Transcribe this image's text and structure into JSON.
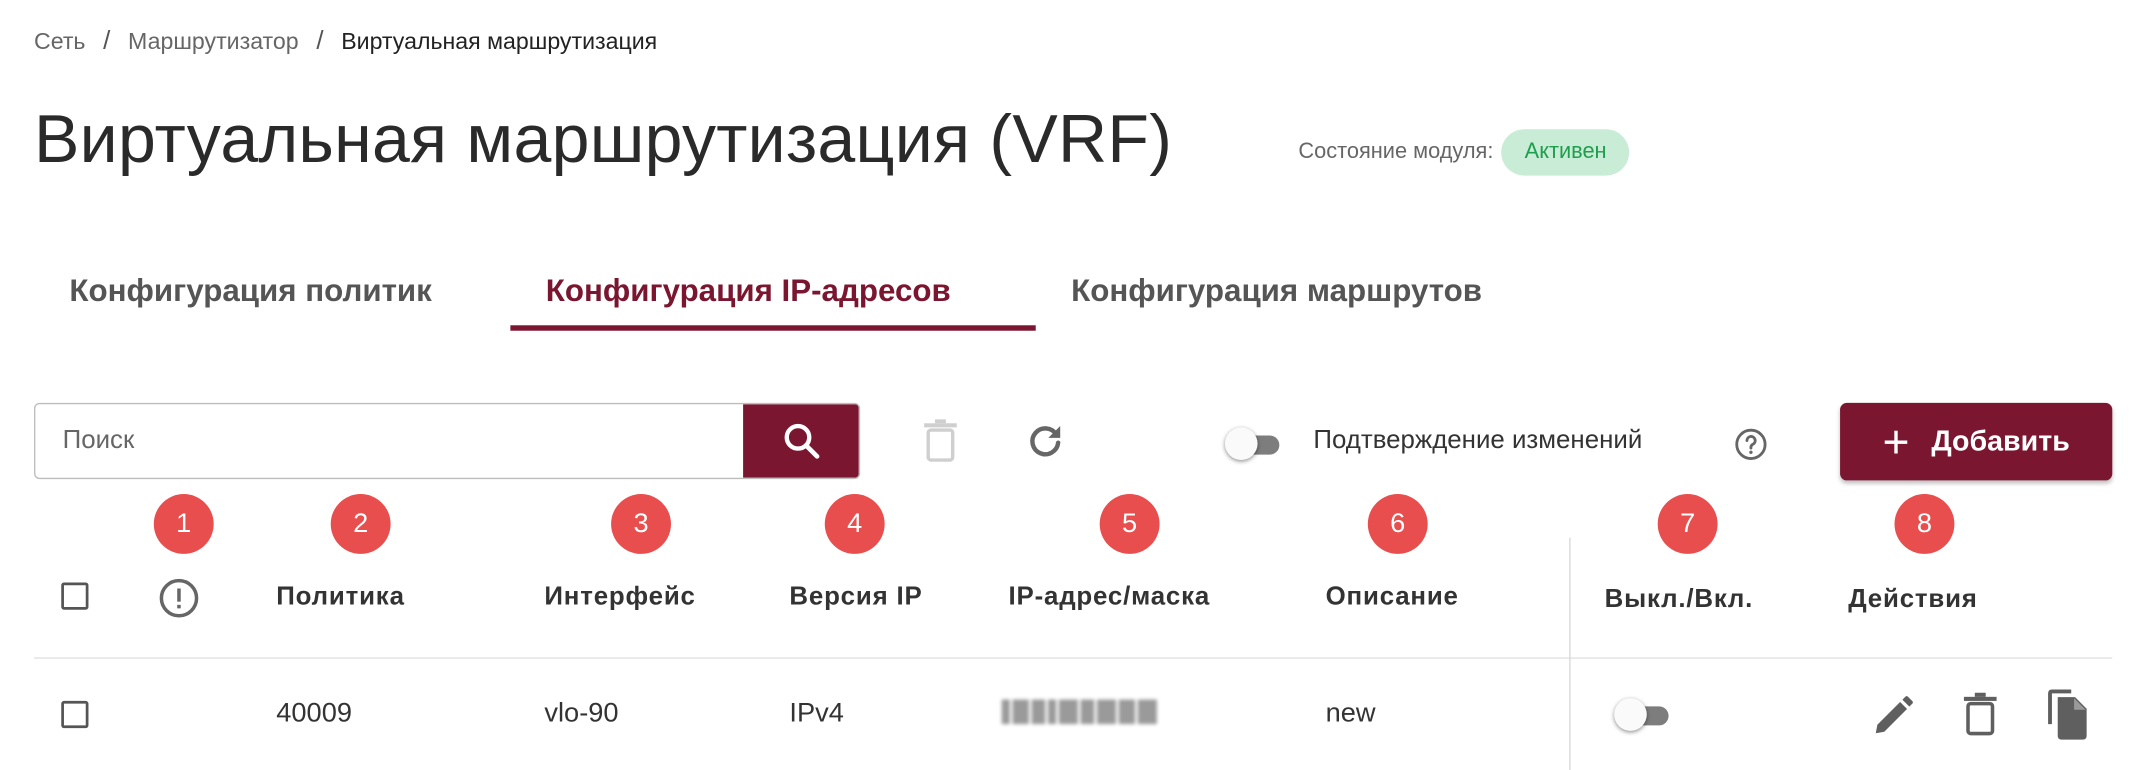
{
  "breadcrumb": [
    "Сеть",
    "Маршрутизатор",
    "Виртуальная маршрутизация"
  ],
  "breadcrumb_separator": "/",
  "page_title": "Виртуальная маршрутизация (VRF)",
  "module_status": {
    "label": "Состояние модуля:",
    "value": "Активен",
    "color": "#1f9e4d",
    "background": "#c9ecd6"
  },
  "tabs": [
    {
      "label": "Конфигурация политик",
      "active": false
    },
    {
      "label": "Конфигурация IP-адресов",
      "active": true
    },
    {
      "label": "Конфигурация маршрутов",
      "active": false
    }
  ],
  "toolbar": {
    "search_placeholder": "Поиск",
    "search_icon": "search-icon",
    "delete_icon": "trash-icon",
    "refresh_icon": "refresh-icon",
    "confirm_label": "Подтверждение изменений",
    "confirm_enabled": false,
    "help_icon": "help-circle-icon",
    "add_label": "Добавить"
  },
  "markers": [
    "1",
    "2",
    "3",
    "4",
    "5",
    "6",
    "7",
    "8"
  ],
  "table": {
    "columns": [
      "Политика",
      "Интерфейс",
      "Версия IP",
      "IP-адрес/маска",
      "Описание",
      "Выкл./Вкл.",
      "Действия"
    ],
    "rows": [
      {
        "policy": "40009",
        "interface": "vlo-90",
        "ip_version": "IPv4",
        "ip_mask": "",
        "description": "new",
        "enabled": false
      }
    ]
  },
  "colors": {
    "accent": "#7b1630",
    "marker": "#e84e4e"
  }
}
